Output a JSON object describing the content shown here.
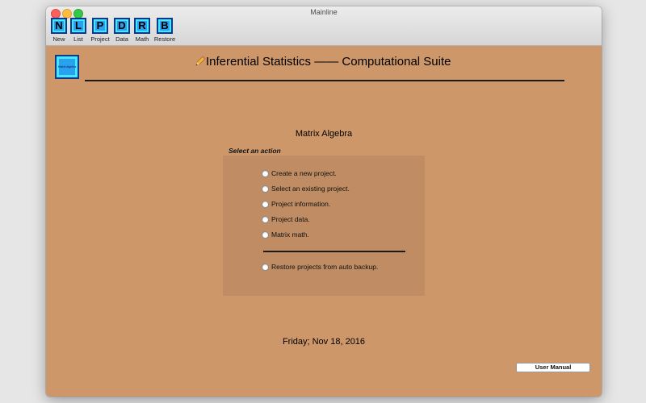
{
  "window": {
    "title": "Mainline"
  },
  "toolbar": {
    "items": [
      {
        "key": "N",
        "label": "New"
      },
      {
        "key": "L",
        "label": "List"
      },
      {
        "key": "P",
        "label": "Project"
      },
      {
        "key": "D",
        "label": "Data"
      },
      {
        "key": "R",
        "label": "Math"
      },
      {
        "key": "B",
        "label": "Restore"
      }
    ]
  },
  "header": {
    "logo_text": "Matrix Algebra",
    "title": "Inferential Statistics —— Computational Suite",
    "title_icon": "pencil-icon"
  },
  "main": {
    "section_title": "Matrix Algebra",
    "panel_caption": "Select an action",
    "actions": [
      {
        "label": "Create a new project.",
        "selected": false
      },
      {
        "label": "Select an existing project.",
        "selected": false
      },
      {
        "label": "Project information.",
        "selected": false
      },
      {
        "label": "Project data.",
        "selected": false
      },
      {
        "label": "Matrix math.",
        "selected": false
      }
    ],
    "restore_action": {
      "label": "Restore projects from auto backup.",
      "selected": false
    },
    "date": "Friday; Nov 18, 2016",
    "manual_button": "User Manual"
  },
  "colors": {
    "background": "#cd976a",
    "panel": "#bf8c63",
    "toolbar_key": "#2aa0f0",
    "toolbar_key_border": "#0b3a8a"
  }
}
